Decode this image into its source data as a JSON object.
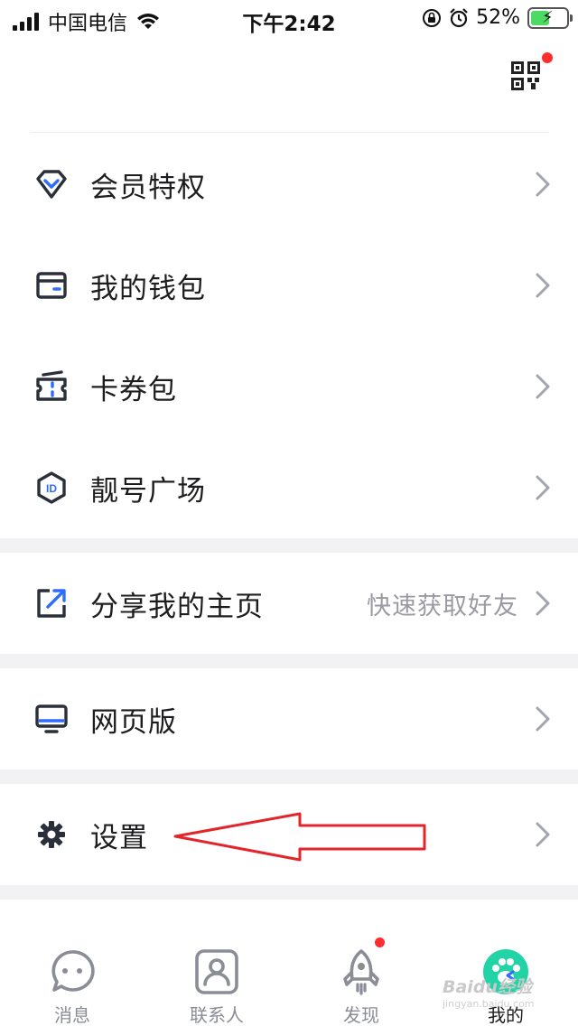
{
  "status_bar": {
    "carrier": "中国电信",
    "time": "下午2:42",
    "battery_percent": "52%",
    "battery_level": 0.52
  },
  "header": {
    "qr_icon": "qr-code-icon",
    "has_notification": true
  },
  "menu": {
    "vip": {
      "label": "会员特权",
      "icon": "diamond-icon"
    },
    "wallet": {
      "label": "我的钱包",
      "icon": "wallet-icon"
    },
    "coupons": {
      "label": "卡券包",
      "icon": "ticket-icon"
    },
    "pretty_id": {
      "label": "靓号广场",
      "icon": "id-badge-icon"
    },
    "share": {
      "label": "分享我的主页",
      "hint": "快速获取好友",
      "icon": "share-icon"
    },
    "web": {
      "label": "网页版",
      "icon": "monitor-icon"
    },
    "settings": {
      "label": "设置",
      "icon": "gear-icon"
    }
  },
  "tabs": [
    {
      "label": "消息",
      "icon": "chat-bubble-icon",
      "active": false
    },
    {
      "label": "联系人",
      "icon": "contacts-icon",
      "active": false
    },
    {
      "label": "发现",
      "icon": "rocket-icon",
      "active": false,
      "badge": true
    },
    {
      "label": "我的",
      "icon": "paw-avatar-icon",
      "active": true
    }
  ],
  "watermark": {
    "text": "Baidu经验",
    "sub": "jingyan.baidu.com"
  },
  "colors": {
    "accent": "#2f6bff",
    "icon_dark": "#2b2f3a",
    "badge_red": "#ff2d2d",
    "annotation_red": "#e3242b",
    "active_tab": "#22d3a6"
  }
}
